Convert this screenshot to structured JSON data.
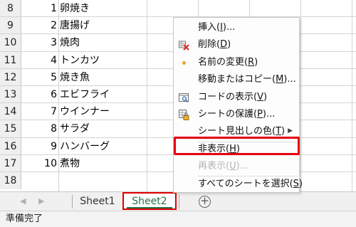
{
  "rows": [
    {
      "header": "8",
      "num": "1",
      "name": "卵焼き"
    },
    {
      "header": "9",
      "num": "2",
      "name": "唐揚げ"
    },
    {
      "header": "10",
      "num": "3",
      "name": "焼肉"
    },
    {
      "header": "11",
      "num": "4",
      "name": "トンカツ"
    },
    {
      "header": "12",
      "num": "5",
      "name": "焼き魚"
    },
    {
      "header": "13",
      "num": "6",
      "name": "エビフライ"
    },
    {
      "header": "14",
      "num": "7",
      "name": "ウインナー"
    },
    {
      "header": "15",
      "num": "8",
      "name": "サラダ"
    },
    {
      "header": "16",
      "num": "9",
      "name": "ハンバーグ"
    },
    {
      "header": "17",
      "num": "10",
      "name": "煮物"
    },
    {
      "header": "18",
      "num": "",
      "name": ""
    }
  ],
  "tabs": {
    "nav_prev": "◀",
    "nav_next": "▶",
    "sheet1": "Sheet1",
    "sheet2": "Sheet2",
    "add": "+"
  },
  "status": {
    "text": "準備完了"
  },
  "context_menu": {
    "items": [
      {
        "label": "挿入(I)...",
        "icon": "",
        "disabled": false
      },
      {
        "label": "削除(D)",
        "icon": "delete-sheet-icon",
        "disabled": false
      },
      {
        "label": "名前の変更(R)",
        "icon": "bullet-dot-icon",
        "disabled": false
      },
      {
        "label": "移動またはコピー(M)...",
        "icon": "",
        "disabled": false
      },
      {
        "label": "コードの表示(V)",
        "icon": "view-code-icon",
        "disabled": false
      },
      {
        "label": "シートの保護(P)...",
        "icon": "protect-sheet-icon",
        "disabled": false
      },
      {
        "label": "シート見出しの色(T)",
        "icon": "",
        "disabled": false,
        "submenu": true
      },
      {
        "label": "非表示(H)",
        "icon": "",
        "disabled": false
      },
      {
        "label": "再表示(U)...",
        "icon": "",
        "disabled": true
      },
      {
        "label": "すべてのシートを選択(S)",
        "icon": "",
        "disabled": false
      }
    ]
  },
  "colors": {
    "accent_green": "#217346",
    "highlight_red": "#e60012",
    "orange_dot": "#f0a030"
  }
}
